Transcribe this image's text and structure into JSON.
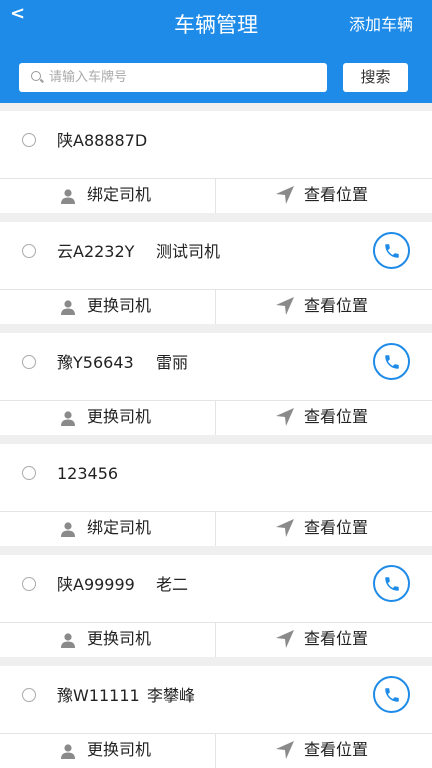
{
  "header": {
    "back_icon": "chevron-left-icon",
    "back_glyph": "<",
    "title": "车辆管理",
    "add_label": "添加车辆"
  },
  "search": {
    "placeholder": "请输入车牌号",
    "button_label": "搜索"
  },
  "vehicles": [
    {
      "plate": "陕A88887D",
      "driver": "",
      "has_phone": false,
      "driver_action": "绑定司机",
      "location_action": "查看位置"
    },
    {
      "plate": "云A2232Y",
      "driver": "测试司机",
      "has_phone": true,
      "driver_action": "更换司机",
      "location_action": "查看位置"
    },
    {
      "plate": "豫Y56643",
      "driver": "雷丽",
      "has_phone": true,
      "driver_action": "更换司机",
      "location_action": "查看位置"
    },
    {
      "plate": "123456",
      "driver": "",
      "has_phone": false,
      "driver_action": "绑定司机",
      "location_action": "查看位置"
    },
    {
      "plate": "陕A99999",
      "driver": "老二",
      "has_phone": true,
      "driver_action": "更换司机",
      "location_action": "查看位置"
    },
    {
      "plate": "豫W11111",
      "driver": "李攀峰",
      "has_phone": true,
      "driver_action": "更换司机",
      "location_action": "查看位置"
    }
  ],
  "colors": {
    "primary": "#1e8be8",
    "background": "#efefef"
  }
}
